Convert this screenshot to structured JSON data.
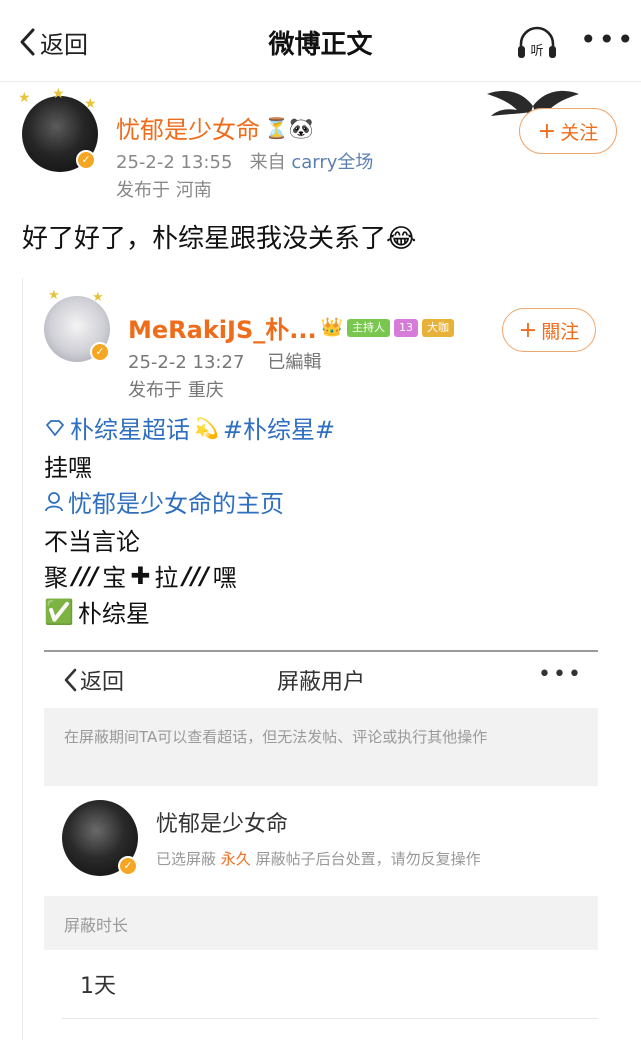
{
  "nav": {
    "back_label": "返回",
    "title": "微博正文",
    "listen_label": "听",
    "more_label": "•••"
  },
  "post": {
    "username": "忧郁是少女命",
    "username_emoji": "⏳🐼",
    "date": "25-2-2 13:55",
    "source_prefix": "来自",
    "source": "carry全场",
    "location": "发布于 河南",
    "follow_label": "关注",
    "text": "好了好了，朴综星跟我没关系了😂"
  },
  "embedded": {
    "username": "MeRakiJS_朴...",
    "badge_host": "主持人",
    "badge_level": "13",
    "badge_big": "大咖",
    "date": "25-2-2 13:27",
    "edited": "已編輯",
    "location": "发布于 重庆",
    "follow_label": "關注",
    "lines": {
      "l1_topic": "朴综星超话",
      "l1_star": "💫",
      "l1_tag": "#朴综星#",
      "l2": "挂嘿",
      "l3": "忧郁是少女命的主页",
      "l4": "不当言论",
      "l5_a": "聚",
      "l5_b": "///",
      "l5_c": "宝",
      "l5_d": "✚",
      "l5_e": "拉",
      "l5_f": "///",
      "l5_g": "嘿",
      "l6_check": "✅",
      "l6_text": "朴综星"
    }
  },
  "block_screen": {
    "back_label": "返回",
    "title": "屏蔽用户",
    "more_label": "•••",
    "notice": "在屏蔽期间TA可以查看超话，但无法发帖、评论或执行其他操作",
    "username": "忧郁是少女命",
    "status_prefix": "已选屏蔽",
    "status_duration": "永久",
    "status_suffix": "屏蔽帖子后台处置，请勿反复操作",
    "duration_header": "屏蔽时长",
    "duration_option": "1天"
  },
  "colors": {
    "accent_orange": "#ef6c1a",
    "link_blue": "#2f6fbf",
    "verified_badge": "#f6a623"
  }
}
